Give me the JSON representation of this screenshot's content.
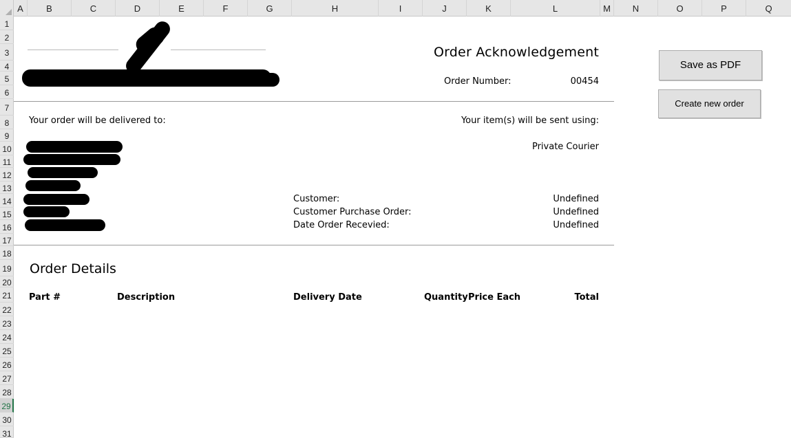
{
  "columns": [
    "A",
    "B",
    "C",
    "D",
    "E",
    "F",
    "G",
    "H",
    "I",
    "J",
    "K",
    "L",
    "M",
    "N",
    "O",
    "P",
    "Q"
  ],
  "rows": [
    "1",
    "2",
    "3",
    "4",
    "5",
    "6",
    "7",
    "8",
    "9",
    "10",
    "11",
    "12",
    "13",
    "14",
    "15",
    "16",
    "17",
    "18",
    "19",
    "20",
    "21",
    "22",
    "23",
    "24",
    "25",
    "26",
    "27",
    "28",
    "29",
    "30",
    "31"
  ],
  "selected_row": "29",
  "document": {
    "title": "Order Acknowledgement",
    "order_number_label": "Order Number:",
    "order_number_value": "00454",
    "delivered_to_label": "Your order will be delivered to:",
    "sent_using_label": "Your item(s) will be sent using:",
    "shipping_method": "Private Courier",
    "customer_label": "Customer:",
    "customer_value": "Undefined",
    "customer_po_label": "Customer Purchase Order:",
    "customer_po_value": "Undefined",
    "date_received_label": "Date Order Recevied:",
    "date_received_value": "Undefined",
    "details_title": "Order Details",
    "table_headers": {
      "part": "Part #",
      "description": "Description",
      "delivery_date": "Delivery Date",
      "quantity": "Quantity",
      "price_each": "Price Each",
      "total": "Total"
    }
  },
  "buttons": {
    "save_pdf": "Save as PDF",
    "new_order": "Create new order"
  },
  "colors": {
    "header_bg": "#e6e6e6",
    "selected_row_accent": "#217346",
    "redaction": "#000000"
  }
}
